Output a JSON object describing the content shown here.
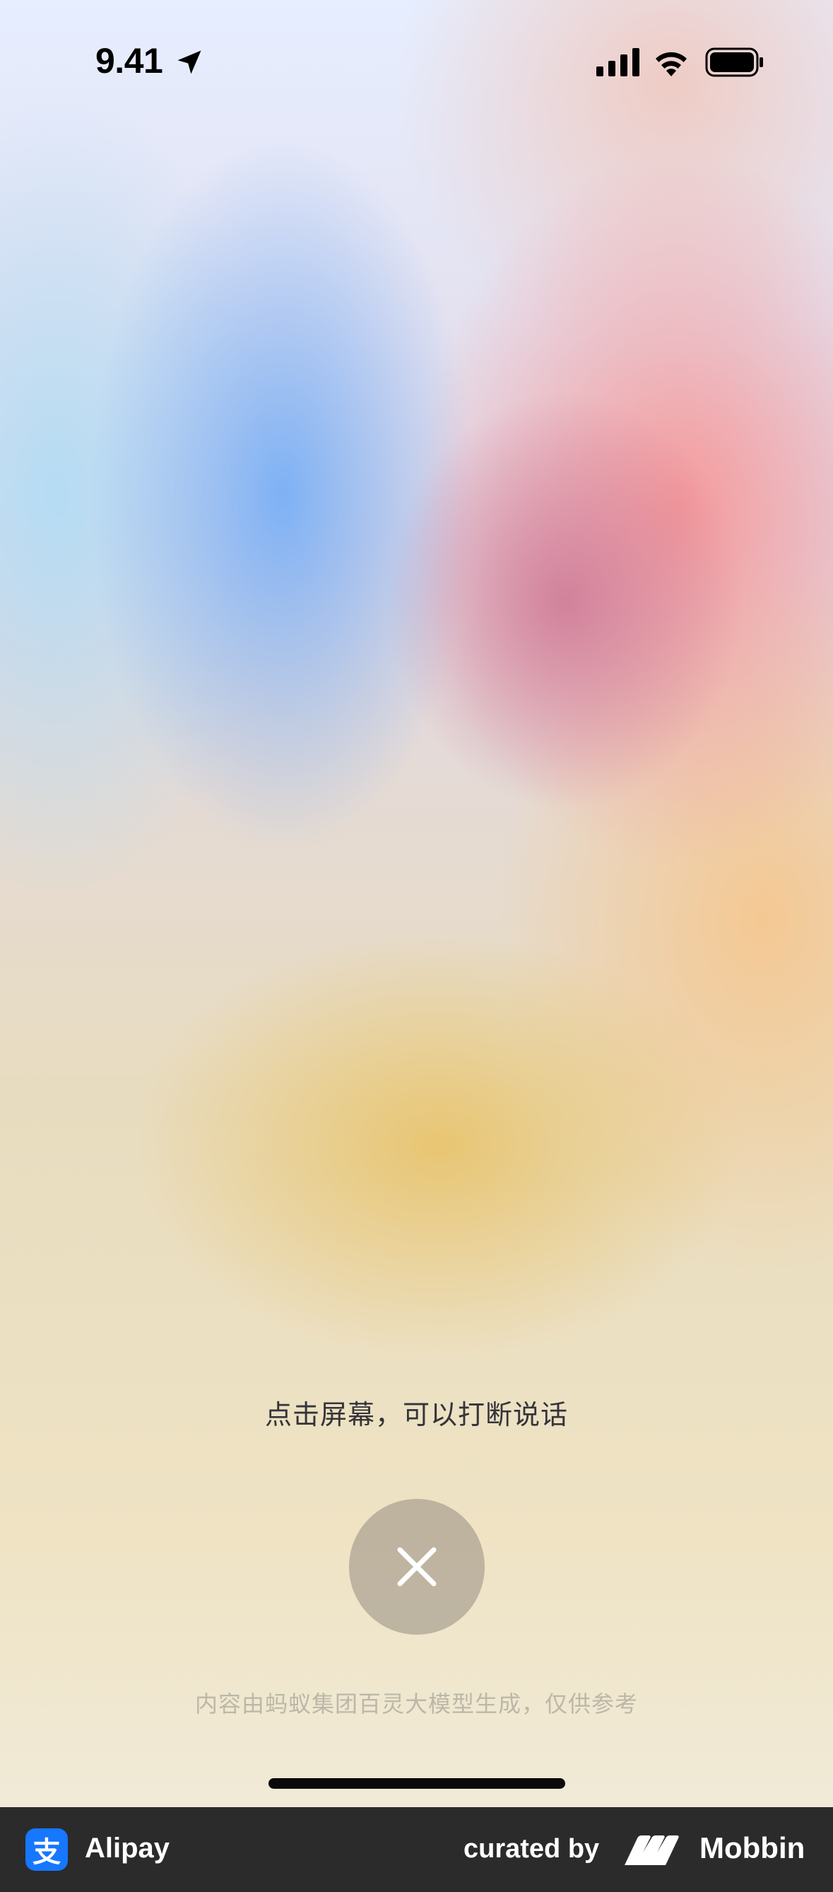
{
  "status_bar": {
    "time": "9.41",
    "icons": [
      "location-arrow-icon",
      "cellular-signal-icon",
      "wifi-icon",
      "battery-icon"
    ]
  },
  "voice_screen": {
    "hint": "点击屏幕，可以打断说话",
    "close_icon": "close-icon",
    "disclaimer": "内容由蚂蚁集团百灵大模型生成，仅供参考"
  },
  "attribution": {
    "app_logo_glyph": "支",
    "app_name": "Alipay",
    "curated_label": "curated by",
    "brand_name": "Mobbin",
    "colors": {
      "bar_background": "#2b2b2b",
      "app_logo": "#1677ff"
    }
  }
}
